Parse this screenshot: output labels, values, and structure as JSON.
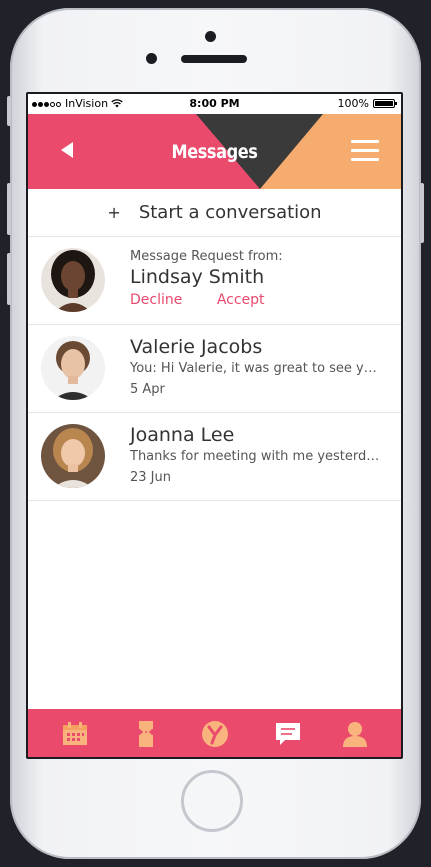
{
  "status_bar": {
    "carrier": "InVision",
    "time": "8:00 PM",
    "battery": "100%"
  },
  "header": {
    "title": "Messages"
  },
  "start_conversation": {
    "plus": "+",
    "label": "Start a conversation"
  },
  "conversations": [
    {
      "type": "request",
      "prefix": "Message Request from:",
      "name": "Lindsay Smith",
      "decline": "Decline",
      "accept": "Accept"
    },
    {
      "type": "message",
      "name": "Valerie Jacobs",
      "preview": "You: Hi Valerie, it was great to see yo…",
      "date": "5 Apr"
    },
    {
      "type": "message",
      "name": "Joanna Lee",
      "preview": "Thanks for meeting with me yesterd…",
      "date": "23 Jun"
    }
  ],
  "tabs": [
    "calendar-icon",
    "ticket-icon",
    "y-logo-icon",
    "chat-icon",
    "profile-icon"
  ],
  "colors": {
    "accent": "#ea4b6d",
    "accent_orange": "#f7ac6f",
    "dark": "#3a3a3a",
    "tab_icon": "#f9b47d"
  }
}
